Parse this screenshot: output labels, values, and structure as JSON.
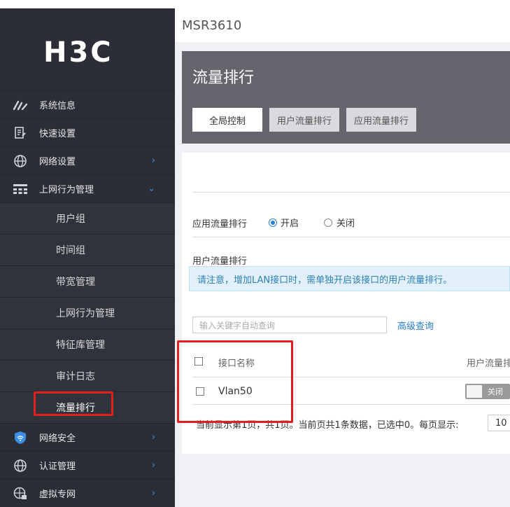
{
  "brand": {
    "logo_text": "H3C"
  },
  "sidebar": {
    "items": [
      {
        "label": "系统信息",
        "icon": "speedometer-icon",
        "expandable": false
      },
      {
        "label": "快速设置",
        "icon": "clipboard-icon",
        "expandable": false
      },
      {
        "label": "网络设置",
        "icon": "globe-icon",
        "expandable": true
      },
      {
        "label": "上网行为管理",
        "icon": "network-grid-icon",
        "expandable": true,
        "expanded": true
      }
    ],
    "sub_items": [
      "用户组",
      "时间组",
      "带宽管理",
      "上网行为管理",
      "特征库管理",
      "审计日志",
      "流量排行"
    ],
    "bottom_items": [
      {
        "label": "网络安全",
        "icon": "shield-wifi-icon"
      },
      {
        "label": "认证管理",
        "icon": "globe-icon"
      },
      {
        "label": "虚拟专网",
        "icon": "globe-lock-icon"
      }
    ],
    "active_sub_item": "流量排行"
  },
  "header": {
    "model": "MSR3610"
  },
  "page": {
    "title": "流量排行",
    "tabs": [
      "全局控制",
      "用户流量排行",
      "应用流量排行"
    ],
    "active_tab": "全局控制"
  },
  "app_ranking": {
    "label": "应用流量排行",
    "on_label": "开启",
    "off_label": "关闭",
    "selected": "开启"
  },
  "user_ranking": {
    "label": "用户流量排行",
    "notice": "请注意，增加LAN接口时，需单独开启该接口的用户流量排行。"
  },
  "search": {
    "placeholder": "输入关键字自动查询",
    "advanced_label": "高级查询"
  },
  "table": {
    "headers": [
      "接口名称",
      "用户流量排"
    ],
    "rows": [
      {
        "interface": "Vlan50",
        "toggle_label": "关闭"
      }
    ]
  },
  "pager": {
    "text": "当前显示第1页，共1页。当前页共1条数据，已选中0。每页显示:",
    "page_size": "10"
  },
  "colors": {
    "sidebar_bg": "#2b2e36",
    "accent": "#2a7fd4",
    "highlight": "#e21e1e",
    "panel_head": "#65656d"
  }
}
